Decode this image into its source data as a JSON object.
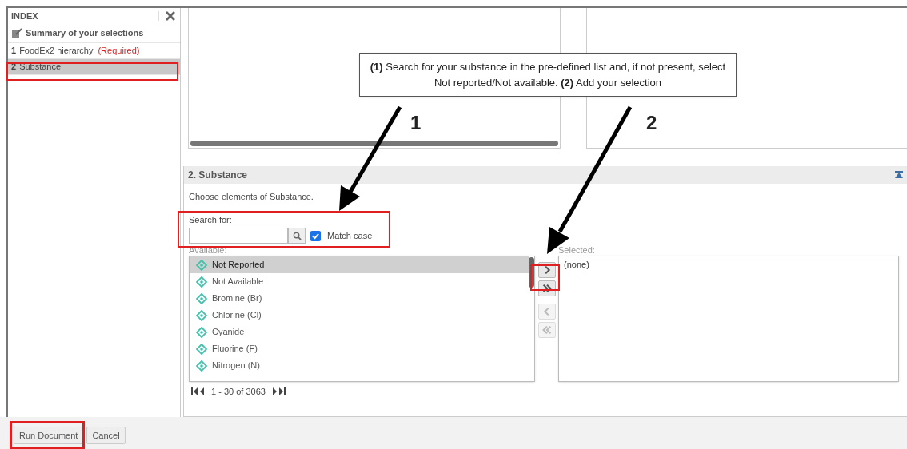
{
  "sidebar": {
    "title": "INDEX",
    "summary": "Summary of your selections",
    "items": [
      {
        "number": "1",
        "label": "FoodEx2 hierarchy",
        "note": "(Required)",
        "selected": false
      },
      {
        "number": "2",
        "label": "Substance",
        "selected": true
      }
    ]
  },
  "callout": {
    "text": "**(1)** Search for your substance in the pre-defined list and, if not present, select Not reported/Not available. **(2)** Add your selection",
    "markers": [
      "1",
      "2"
    ]
  },
  "section": {
    "title": "2. Substance",
    "description": "Choose elements of Substance.",
    "search_label": "Search for:",
    "match_case": {
      "label": "Match case",
      "checked": true
    },
    "available_label": "Available:",
    "available": [
      {
        "label": "Not Reported",
        "selected": true
      },
      {
        "label": "Not Available",
        "selected": false
      },
      {
        "label": "Bromine (Br)",
        "selected": false
      },
      {
        "label": "Chlorine (Cl)",
        "selected": false
      },
      {
        "label": "Cyanide",
        "selected": false
      },
      {
        "label": "Fluorine (F)",
        "selected": false
      },
      {
        "label": "Nitrogen (N)",
        "selected": false
      }
    ],
    "pagination": "1 - 30 of 3063",
    "transfer_buttons": [
      {
        "kind": "add",
        "disabled": false
      },
      {
        "kind": "add_all",
        "disabled": false
      },
      {
        "kind": "remove",
        "disabled": true
      },
      {
        "kind": "remove_all",
        "disabled": true
      }
    ],
    "selected_label": "Selected:",
    "selected": [
      "(none)"
    ]
  },
  "buttons": [
    "Run Document",
    "Cancel"
  ]
}
